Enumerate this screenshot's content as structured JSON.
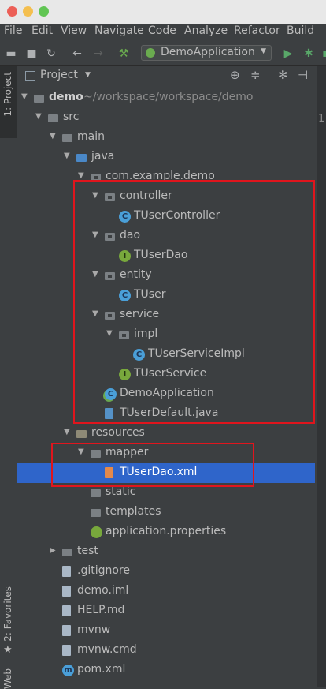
{
  "menu": [
    "File",
    "Edit",
    "View",
    "Navigate",
    "Code",
    "Analyze",
    "Refactor",
    "Build"
  ],
  "toolbar": {
    "run_config": "DemoApplication"
  },
  "side_tabs": {
    "project": "1: Project",
    "favorites": "2: Favorites",
    "web": "Web"
  },
  "panel": {
    "title": "Project"
  },
  "editor": {
    "line": "1"
  },
  "tree": [
    {
      "depth": 0,
      "arrow": "down",
      "icon": "folder",
      "label": "demo",
      "path": " ~/workspace/workspace/demo",
      "bold": true
    },
    {
      "depth": 1,
      "arrow": "down",
      "icon": "folder",
      "label": "src"
    },
    {
      "depth": 2,
      "arrow": "down",
      "icon": "folder",
      "label": "main"
    },
    {
      "depth": 3,
      "arrow": "down",
      "icon": "folder-blue",
      "label": "java"
    },
    {
      "depth": 4,
      "arrow": "down",
      "icon": "package",
      "label": "com.example.demo"
    },
    {
      "depth": 5,
      "arrow": "down",
      "icon": "package",
      "label": "controller"
    },
    {
      "depth": 6,
      "arrow": "",
      "icon": "class",
      "label": "TUserController"
    },
    {
      "depth": 5,
      "arrow": "down",
      "icon": "package",
      "label": "dao"
    },
    {
      "depth": 6,
      "arrow": "",
      "icon": "interface",
      "label": "TUserDao"
    },
    {
      "depth": 5,
      "arrow": "down",
      "icon": "package",
      "label": "entity"
    },
    {
      "depth": 6,
      "arrow": "",
      "icon": "class",
      "label": "TUser"
    },
    {
      "depth": 5,
      "arrow": "down",
      "icon": "package",
      "label": "service"
    },
    {
      "depth": 6,
      "arrow": "down",
      "icon": "package",
      "label": "impl"
    },
    {
      "depth": 7,
      "arrow": "",
      "icon": "class",
      "label": "TUserServiceImpl"
    },
    {
      "depth": 6,
      "arrow": "",
      "icon": "interface",
      "label": "TUserService"
    },
    {
      "depth": 5,
      "arrow": "",
      "icon": "spring-class",
      "label": "DemoApplication"
    },
    {
      "depth": 5,
      "arrow": "",
      "icon": "java-file",
      "label": "TUserDefault.java"
    },
    {
      "depth": 3,
      "arrow": "down",
      "icon": "folder-tan",
      "label": "resources"
    },
    {
      "depth": 4,
      "arrow": "down",
      "icon": "folder",
      "label": "mapper"
    },
    {
      "depth": 5,
      "arrow": "",
      "icon": "xml-file",
      "label": "TUserDao.xml",
      "selected": true
    },
    {
      "depth": 4,
      "arrow": "",
      "icon": "folder",
      "label": "static"
    },
    {
      "depth": 4,
      "arrow": "",
      "icon": "folder",
      "label": "templates"
    },
    {
      "depth": 4,
      "arrow": "",
      "icon": "properties-file",
      "label": "application.properties"
    },
    {
      "depth": 2,
      "arrow": "right",
      "icon": "folder",
      "label": "test"
    },
    {
      "depth": 2,
      "arrow": "",
      "icon": "file",
      "label": ".gitignore"
    },
    {
      "depth": 2,
      "arrow": "",
      "icon": "file",
      "label": "demo.iml"
    },
    {
      "depth": 2,
      "arrow": "",
      "icon": "md-file",
      "label": "HELP.md"
    },
    {
      "depth": 2,
      "arrow": "",
      "icon": "file",
      "label": "mvnw"
    },
    {
      "depth": 2,
      "arrow": "",
      "icon": "file",
      "label": "mvnw.cmd"
    },
    {
      "depth": 2,
      "arrow": "",
      "icon": "maven-file",
      "label": "pom.xml"
    }
  ]
}
